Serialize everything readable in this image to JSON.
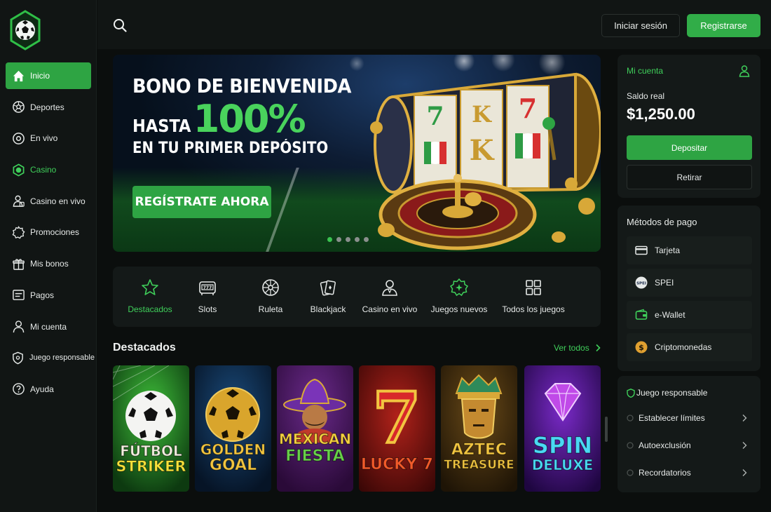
{
  "sidebar": {
    "items": [
      {
        "label": "Inicio",
        "icon": "home-icon"
      },
      {
        "label": "Deportes",
        "icon": "soccer-ball-icon"
      },
      {
        "label": "En vivo",
        "icon": "live-icon"
      },
      {
        "label": "Casino",
        "icon": "casino-chip-icon"
      },
      {
        "label": "Casino en vivo",
        "icon": "dealer-icon"
      },
      {
        "label": "Promociones",
        "icon": "promo-badge-icon"
      },
      {
        "label": "Mis bonos",
        "icon": "gift-icon"
      },
      {
        "label": "Pagos",
        "icon": "wallet-icon"
      },
      {
        "label": "Mi cuenta",
        "icon": "user-icon"
      },
      {
        "label": "Juego responsable",
        "icon": "shield-icon"
      },
      {
        "label": "Ayuda",
        "icon": "help-icon"
      }
    ]
  },
  "header": {
    "login_label": "Iniciar sesión",
    "register_label": "Registrarse"
  },
  "hero": {
    "title": "BONO DE BIENVENIDA",
    "hasta": "HASTA",
    "percent": "100%",
    "subtitle": "EN TU PRIMER DEPÓSITO",
    "cta_label": "REGÍSTRATE AHORA",
    "slide_count": 5,
    "active_slide": 1
  },
  "categories": [
    {
      "label": "Destacados",
      "icon": "star-icon"
    },
    {
      "label": "Slots",
      "icon": "slot-machine-icon"
    },
    {
      "label": "Ruleta",
      "icon": "roulette-icon"
    },
    {
      "label": "Blackjack",
      "icon": "cards-icon"
    },
    {
      "label": "Casino en vivo",
      "icon": "dealer-icon"
    },
    {
      "label": "Juegos nuevos",
      "icon": "new-games-icon"
    },
    {
      "label": "Todos los juegos",
      "icon": "grid-icon"
    }
  ],
  "featured": {
    "title": "Destacados",
    "see_all_label": "Ver todos",
    "games": [
      {
        "line1": "FÚTBOL",
        "line2": "STRIKER"
      },
      {
        "line1": "GOLDEN",
        "line2": "GOAL"
      },
      {
        "line1": "MEXICAN",
        "line2": "FIESTA"
      },
      {
        "line1": "LUCKY 7",
        "line2": ""
      },
      {
        "line1": "AZTEC",
        "line2": "TREASURE"
      },
      {
        "line1": "SPIN",
        "line2": "DELUXE"
      }
    ]
  },
  "account": {
    "title": "Mi cuenta",
    "balance_label": "Saldo real",
    "balance_value": "$1,250.00",
    "deposit_label": "Depositar",
    "withdraw_label": "Retirar"
  },
  "payments": {
    "title": "Métodos de pago",
    "methods": [
      {
        "label": "Tarjeta",
        "icon": "card-icon"
      },
      {
        "label": "SPEI",
        "icon": "spei-icon",
        "badge": "SPEI"
      },
      {
        "label": "e-Wallet",
        "icon": "ewallet-icon"
      },
      {
        "label": "Criptomonedas",
        "icon": "crypto-coin-icon"
      }
    ]
  },
  "responsible": {
    "title": "Juego responsable",
    "items": [
      {
        "label": "Establecer límites"
      },
      {
        "label": "Autoexclusión"
      },
      {
        "label": "Recordatorios"
      }
    ]
  },
  "colors": {
    "accent": "#2ea443",
    "accent_text": "#3fcf5a",
    "background": "#0b0e0d",
    "panel": "#141918"
  }
}
